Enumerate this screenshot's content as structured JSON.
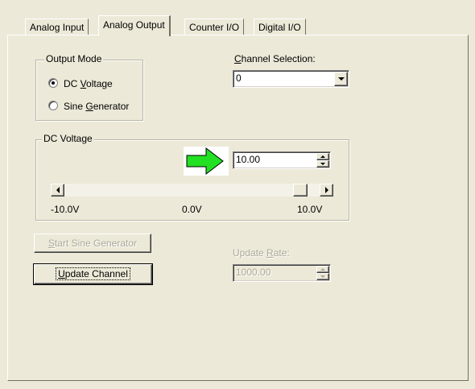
{
  "tabs": [
    {
      "label": "Analog Input",
      "active": false
    },
    {
      "label": "Analog Output",
      "active": true
    },
    {
      "label": "Counter I/O",
      "active": false
    },
    {
      "label": "Digital I/O",
      "active": false
    }
  ],
  "output_mode": {
    "title": "Output Mode",
    "options": [
      {
        "prefix": "DC ",
        "mnemonic": "V",
        "suffix": "oltage",
        "selected": true
      },
      {
        "prefix": "Sine ",
        "mnemonic": "G",
        "suffix": "enerator",
        "selected": false
      }
    ]
  },
  "channel_selection": {
    "mnemonic": "C",
    "label_rest": "hannel Selection:",
    "value": "0"
  },
  "dc_voltage": {
    "title": "DC Voltage",
    "value": "10.00",
    "arrow_color": "#22e022",
    "slider_position": 1.0,
    "scale": {
      "min_label": "-10.0V",
      "mid_label": "0.0V",
      "max_label": "10.0V"
    }
  },
  "buttons": {
    "start_sine": {
      "mnemonic": "S",
      "label_rest": "tart Sine Generator",
      "enabled": false
    },
    "update_channel": {
      "mnemonic": "U",
      "label_rest": "pdate Channel",
      "enabled": true
    }
  },
  "update_rate": {
    "label_prefix": "Update ",
    "mnemonic": "R",
    "label_suffix": "ate:",
    "value": "1000.00",
    "enabled": false
  },
  "icons": {
    "radio": "radio-button",
    "combo": "chevron-down-icon",
    "spin": "spin-arrows-icon",
    "scroll_left": "arrow-left-icon",
    "scroll_right": "arrow-right-icon",
    "pointer": "green-right-arrow-icon"
  }
}
